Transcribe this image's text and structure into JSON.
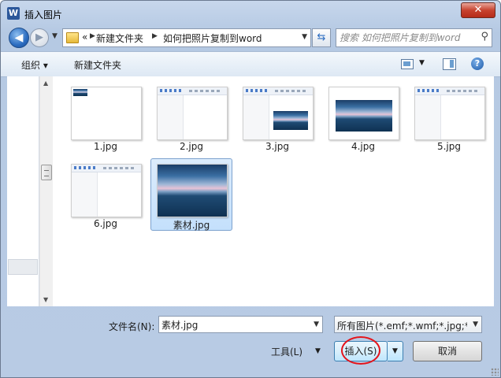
{
  "window": {
    "title": "插入图片",
    "app_icon": "word-icon",
    "close_label": "✕"
  },
  "address": {
    "crumb_root": "«",
    "crumbs": [
      "新建文件夹",
      "如何把照片复制到word"
    ],
    "search_placeholder": "搜索 如何把照片复制到word"
  },
  "toolbar": {
    "organize_label": "组织 ▾",
    "new_folder_label": "新建文件夹"
  },
  "files": [
    {
      "name": "1.jpg",
      "thumb": "doc-small-photo"
    },
    {
      "name": "2.jpg",
      "thumb": "doc-blank"
    },
    {
      "name": "3.jpg",
      "thumb": "doc-with-photo"
    },
    {
      "name": "4.jpg",
      "thumb": "photo"
    },
    {
      "name": "5.jpg",
      "thumb": "doc-blank"
    },
    {
      "name": "6.jpg",
      "thumb": "doc-blank"
    },
    {
      "name": "素材.jpg",
      "thumb": "photo-large",
      "selected": true
    }
  ],
  "bottom": {
    "filename_label": "文件名(N):",
    "filename_value": "素材.jpg",
    "filter_value": "所有图片(*.emf;*.wmf;*.jpg;*.jp",
    "tools_label": "工具(L)",
    "insert_label": "插入(S)",
    "cancel_label": "取消"
  },
  "colors": {
    "annotation_circle": "#e5141b",
    "selection": "#c4e0fc"
  }
}
